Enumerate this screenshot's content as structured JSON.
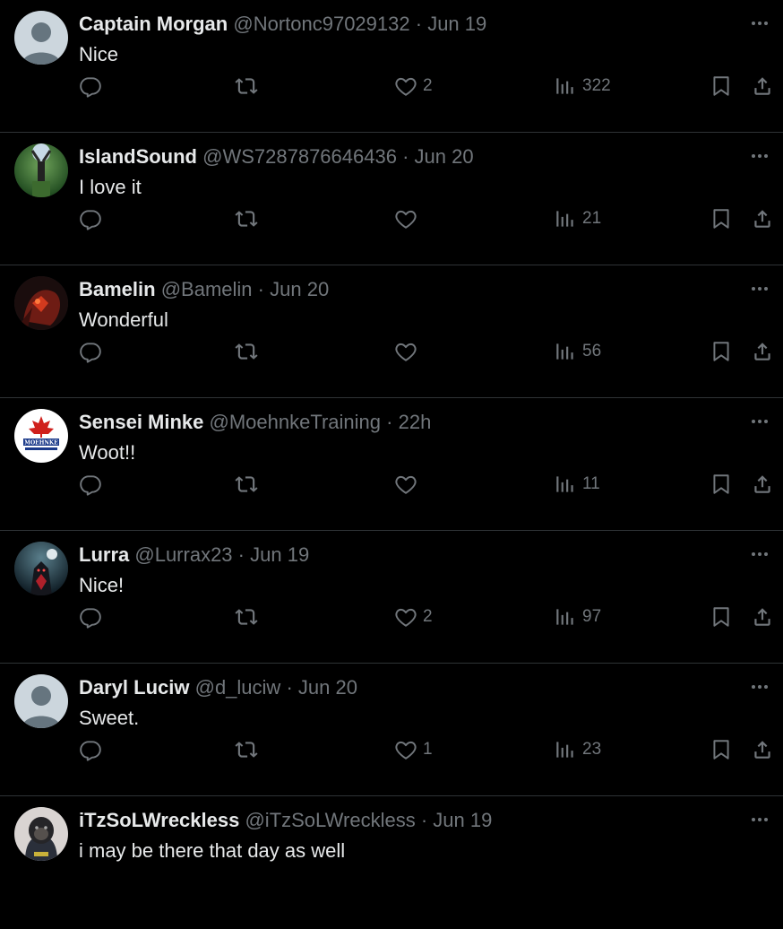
{
  "colors": {
    "background": "#000000",
    "text": "#e7e9ea",
    "muted": "#71767b",
    "divider": "#2f3336"
  },
  "tweets": [
    {
      "name": "Captain Morgan",
      "handle": "@Nortonc97029132",
      "dot": "·",
      "time": "Jun 19",
      "text": "Nice",
      "likes": "2",
      "views": "322",
      "avatar": "default-avatar"
    },
    {
      "name": "IslandSound",
      "handle": "@WS7287876646436",
      "dot": "·",
      "time": "Jun 20",
      "text": "I love it",
      "likes": "",
      "views": "21",
      "avatar": "photo-avatar-green"
    },
    {
      "name": "Bamelin",
      "handle": "@Bamelin",
      "dot": "·",
      "time": "Jun 20",
      "text": "Wonderful",
      "likes": "",
      "views": "56",
      "avatar": "photo-avatar-red"
    },
    {
      "name": "Sensei Minke",
      "handle": "@MoehnkeTraining",
      "dot": "·",
      "time": "22h",
      "text": "Woot!!",
      "likes": "",
      "views": "11",
      "avatar": "logo-avatar",
      "avatar_text": "MOEHNKE"
    },
    {
      "name": "Lurra",
      "handle": "@Lurrax23",
      "dot": "·",
      "time": "Jun 19",
      "text": "Nice!",
      "likes": "2",
      "views": "97",
      "avatar": "photo-avatar-night"
    },
    {
      "name": "Daryl Luciw",
      "handle": "@d_luciw",
      "dot": "·",
      "time": "Jun 20",
      "text": "Sweet.",
      "likes": "1",
      "views": "23",
      "avatar": "default-avatar"
    },
    {
      "name": "iTzSoLWreckless",
      "handle": "@iTzSoLWreckless",
      "dot": "·",
      "time": "Jun 19",
      "text": "i may be there that day as well",
      "likes": "",
      "views": "",
      "avatar": "photo-avatar-gorilla"
    }
  ]
}
